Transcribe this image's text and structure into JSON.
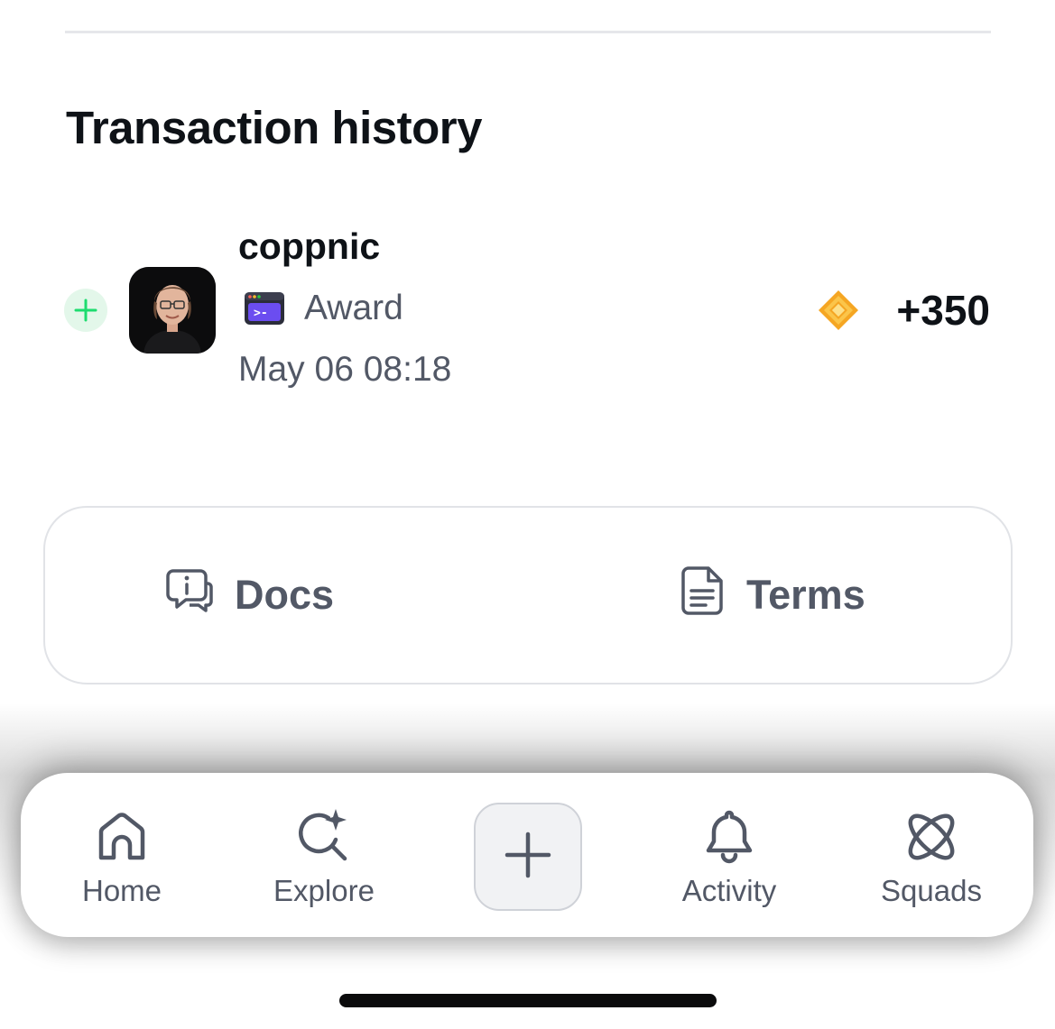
{
  "transaction_history": {
    "title": "Transaction history",
    "items": [
      {
        "direction_icon": "plus-icon",
        "username": "coppnic",
        "type_icon": "terminal-icon",
        "type_label": "Award",
        "date": "May 06 08:18",
        "currency_icon": "core-coin-icon",
        "amount": "+350"
      }
    ]
  },
  "links": {
    "docs_label": "Docs",
    "docs_icon": "docs-chat-icon",
    "terms_label": "Terms",
    "terms_icon": "document-icon"
  },
  "bottom_nav": {
    "tabs": [
      {
        "label": "Home",
        "icon": "home-icon"
      },
      {
        "label": "Explore",
        "icon": "explore-icon"
      },
      {
        "label": "",
        "icon": "plus-icon"
      },
      {
        "label": "Activity",
        "icon": "bell-icon"
      },
      {
        "label": "Squads",
        "icon": "squads-icon"
      }
    ]
  },
  "colors": {
    "text_primary": "#0e1217",
    "text_secondary": "#525866",
    "accent_green": "#1ddc6f",
    "coin_gold": "#f5a623",
    "award_purple": "#6b4df0"
  }
}
